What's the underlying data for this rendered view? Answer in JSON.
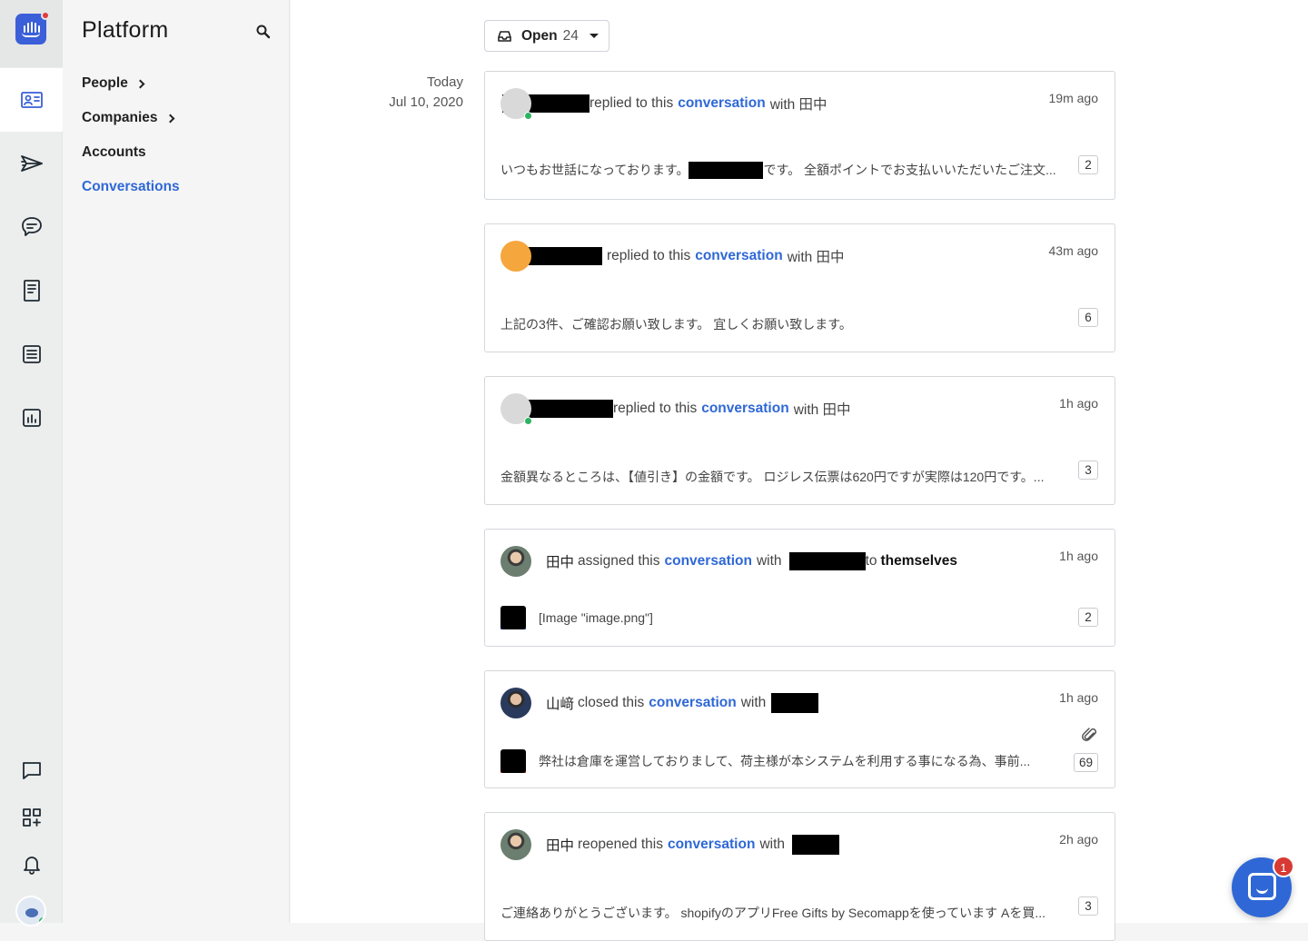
{
  "nav": {
    "title": "Platform",
    "items": [
      {
        "label": "People",
        "has_submenu": true,
        "selected": false
      },
      {
        "label": "Companies",
        "has_submenu": true,
        "selected": false
      },
      {
        "label": "Accounts",
        "has_submenu": false,
        "selected": false
      },
      {
        "label": "Conversations",
        "has_submenu": false,
        "selected": true
      }
    ]
  },
  "rail": {
    "icons": [
      "contacts-icon",
      "outbound-icon",
      "inbox-icon",
      "articles-icon",
      "operator-icon",
      "reports-icon",
      "messenger-icon",
      "app-store-icon",
      "notifications-icon",
      "avatar"
    ]
  },
  "filter": {
    "label": "Open",
    "count": "24"
  },
  "date": {
    "day": "Today",
    "full": "Jul 10, 2020"
  },
  "conversations": [
    {
      "verb": "replied to this",
      "link": "conversation",
      "with": "with 田中",
      "time": "19m ago",
      "preview_a": "いつもお世話になっております。",
      "preview_b": "です。 全額ポイントでお支払いいただいたご注文...",
      "count": "2"
    },
    {
      "verb": "replied to this",
      "link": "conversation",
      "with": "with 田中",
      "time": "43m ago",
      "preview": "上記の3件、ご確認お願い致します。 宜しくお願い致します。",
      "count": "6"
    },
    {
      "verb": "replied to this",
      "link": "conversation",
      "with": "with 田中",
      "time": "1h ago",
      "preview": "金額異なるところは、【値引き】の金額です。 ロジレス伝票は620円ですが実際は120円です。...",
      "count": "3"
    },
    {
      "actor": "田中",
      "verb": "assigned this",
      "link": "conversation",
      "with": "with",
      "to": "to",
      "target": "themselves",
      "time": "1h ago",
      "preview": "[Image \"image.png\"]",
      "count": "2"
    },
    {
      "actor": "山﨑",
      "verb": "closed this",
      "link": "conversation",
      "with": "with",
      "time": "1h ago",
      "preview": "弊社は倉庫を運営しておりまして、荷主様が本システムを利用する事になる為、事前...",
      "count": "69"
    },
    {
      "actor": "田中",
      "verb": "reopened this",
      "link": "conversation",
      "with": "with",
      "time": "2h ago",
      "preview": "ご連絡ありがとうございます。 shopifyのアプリFree Gifts by Secomappを使っています Aを買...",
      "count": "3"
    }
  ],
  "messenger": {
    "badge": "1"
  }
}
